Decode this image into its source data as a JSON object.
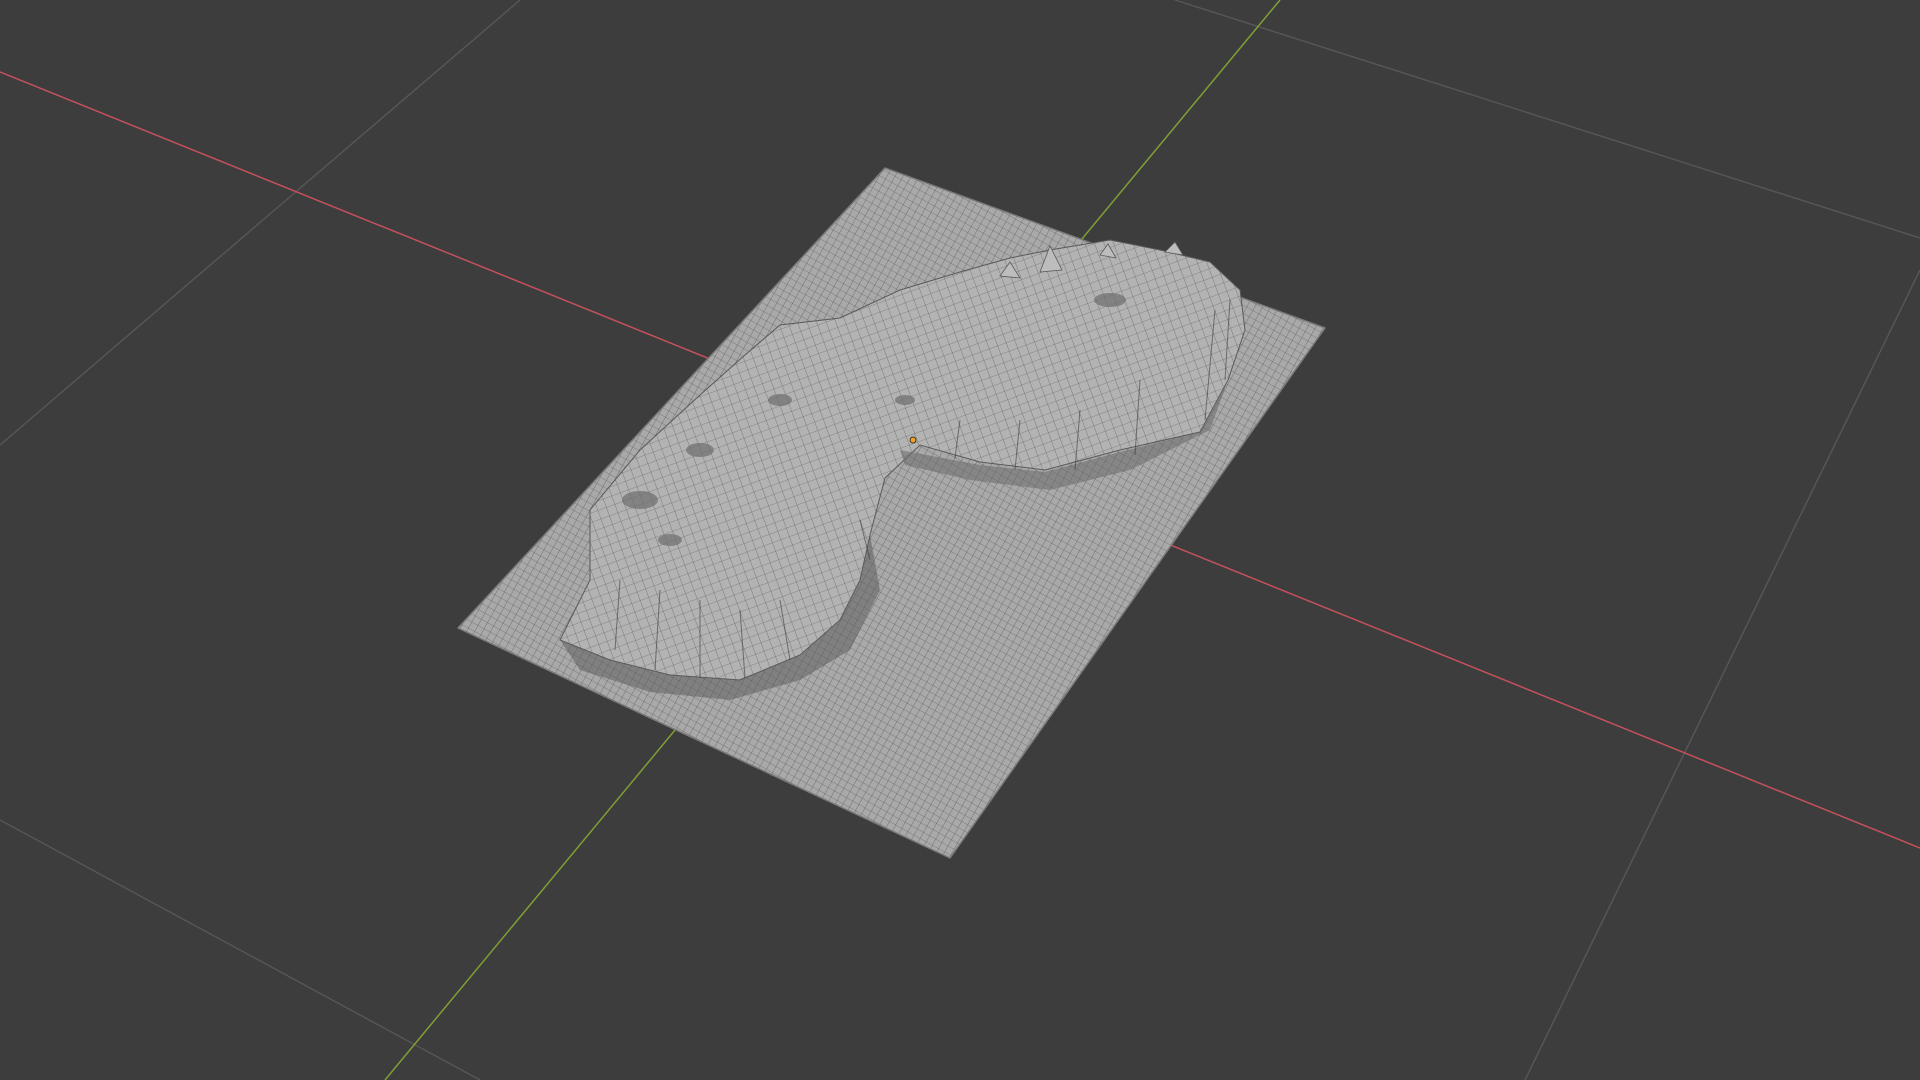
{
  "viewport": {
    "background": "#3d3d3d",
    "grid_color": "#575757",
    "x_axis_color": "#c4515c",
    "y_axis_color": "#7fa032",
    "origin_color": "#f0a22a",
    "mesh_face_color": "#a9a9a9",
    "mesh_wire_color": "#4a4a4a",
    "object": "terrain-plane-displaced",
    "shading": "wireframe"
  }
}
